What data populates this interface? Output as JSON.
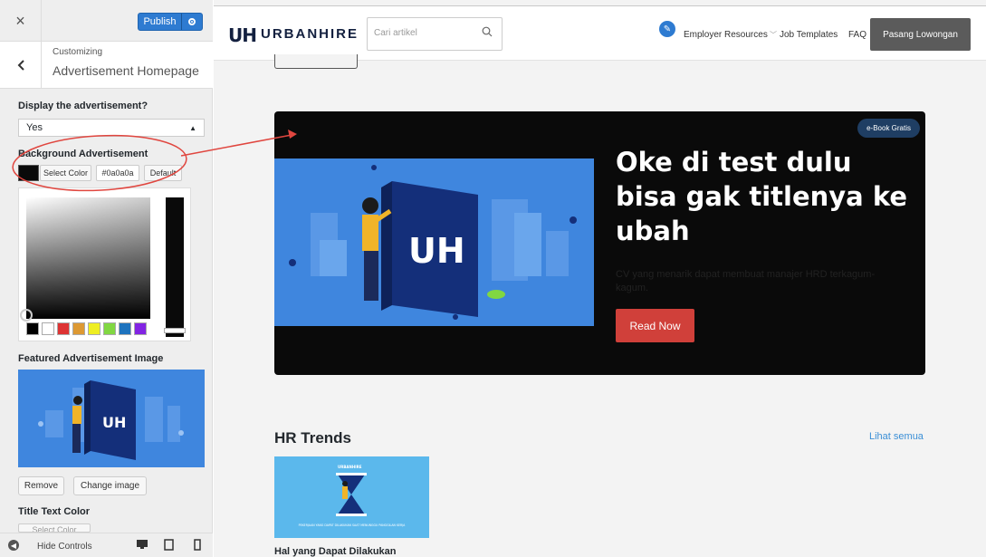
{
  "customizer": {
    "close_icon": "×",
    "publish_label": "Publish",
    "gear_icon": "gear-icon",
    "section_subtitle": "Customizing",
    "section_title": "Advertisement Homepage",
    "back_icon": "‹",
    "display_label": "Display the advertisement?",
    "display_value": "Yes",
    "bg_label": "Background Advertisement",
    "select_color_label": "Select Color",
    "color_value": "#0a0a0a",
    "default_label": "Default",
    "palette": [
      "#000000",
      "#ffffff",
      "#dd3333",
      "#dd9933",
      "#eeee22",
      "#81d742",
      "#1e73be",
      "#8224e3"
    ],
    "featured_label": "Featured Advertisement Image",
    "remove_label": "Remove",
    "change_image_label": "Change image",
    "title_color_label": "Title Text Color",
    "title_select_color": "Select Color",
    "hide_controls_label": "Hide Controls"
  },
  "site": {
    "logo_mark": "UH",
    "logo_text": "URBANHIRE",
    "search_placeholder": "Cari artikel",
    "nav": {
      "employer_resources": "Employer Resources",
      "job_templates": "Job Templates",
      "faq": "FAQ"
    },
    "cta_label": "Pasang Lowongan"
  },
  "banner": {
    "badge": "e-Book Gratis",
    "title": "Oke di test dulu bisa gak titlenya ke ubah",
    "description": "CV yang menarik dapat membuat manajer HRD terkagum-kagum.",
    "button": "Read Now",
    "book_logo": "UH",
    "background_color": "#0a0a0a",
    "accent_color": "#d0403a"
  },
  "hr_trends": {
    "title": "HR Trends",
    "see_all": "Lihat semua",
    "card_brand": "URBANHIRE",
    "card_caption": "PEKERJAAN YANG DAPAT DILAKUKAN SAAT MENUNGGU PANGGILAN KERJA",
    "card_title": "Hal yang Dapat Dilakukan"
  }
}
